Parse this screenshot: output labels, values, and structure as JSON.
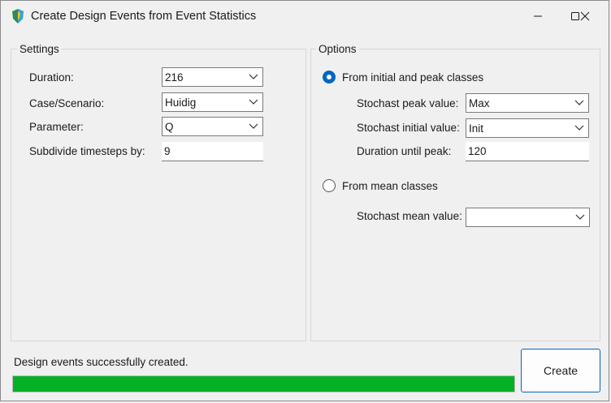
{
  "window": {
    "title": "Create Design Events from Event Statistics",
    "minimize_icon": "minimize-icon",
    "maximize_icon": "maximize-icon",
    "close_icon": "close-icon"
  },
  "settings": {
    "group_label": "Settings",
    "duration": {
      "label": "Duration:",
      "value": "216"
    },
    "case_scenario": {
      "label": "Case/Scenario:",
      "value": "Huidig"
    },
    "parameter": {
      "label": "Parameter:",
      "value": "Q"
    },
    "subdivide": {
      "label": "Subdivide timesteps by:",
      "value": "9"
    }
  },
  "options": {
    "group_label": "Options",
    "initial_peak": {
      "label": "From initial and peak classes",
      "selected": true,
      "stochast_peak": {
        "label": "Stochast peak value:",
        "value": "Max"
      },
      "stochast_initial": {
        "label": "Stochast initial value:",
        "value": "Init"
      },
      "duration_until_peak": {
        "label": "Duration until peak:",
        "value": "120"
      }
    },
    "mean_classes": {
      "label": "From mean classes",
      "selected": false,
      "stochast_mean": {
        "label": "Stochast mean value:",
        "value": ""
      }
    }
  },
  "footer": {
    "status_text": "Design events successfully created.",
    "progress_fraction": 1.0,
    "create_label": "Create"
  },
  "colors": {
    "accent": "#0067c0",
    "progress": "#06b025"
  }
}
